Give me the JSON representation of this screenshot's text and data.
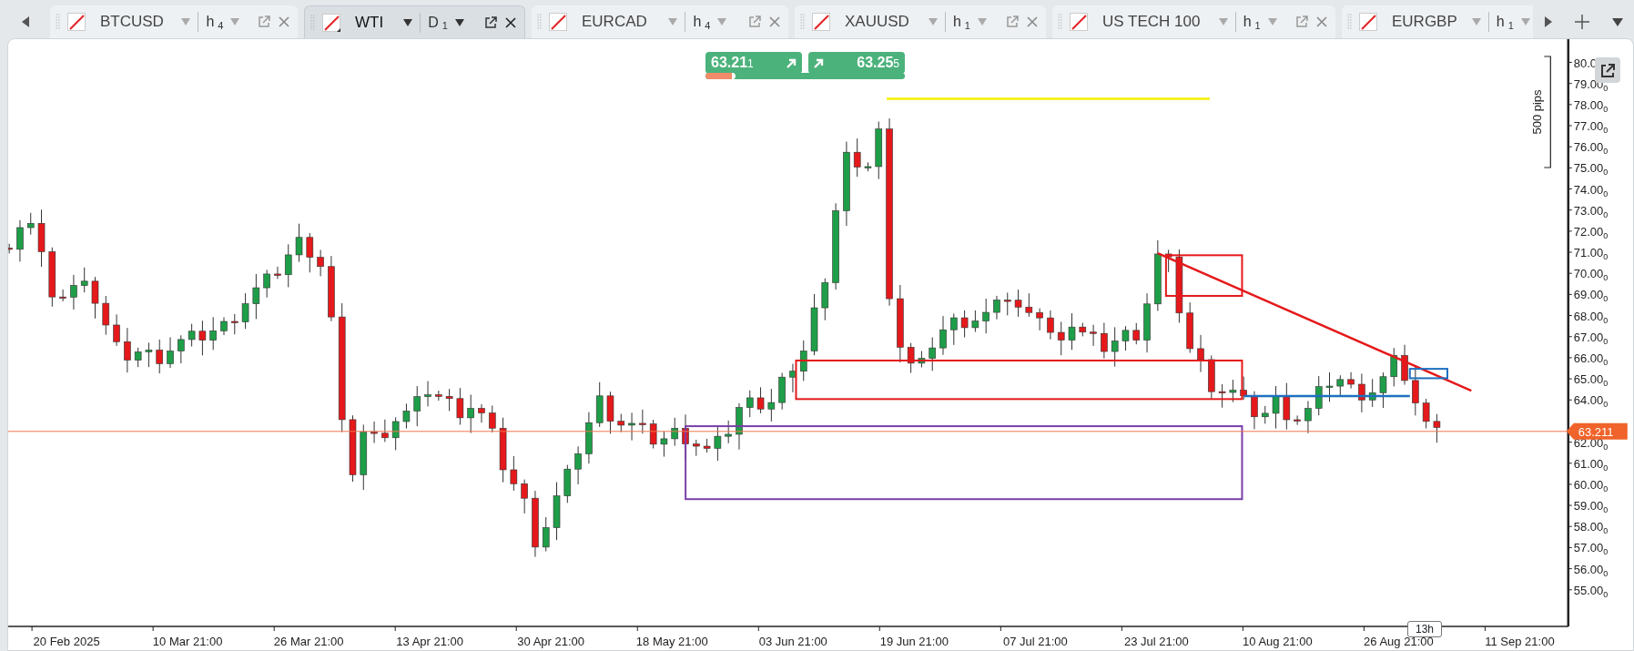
{
  "tabs": [
    {
      "symbol": "BTCUSD",
      "timeframe": "h",
      "timeframe_count": "4",
      "selected": false
    },
    {
      "symbol": "WTI",
      "timeframe": "D",
      "timeframe_count": "1",
      "selected": true
    },
    {
      "symbol": "EURCAD",
      "timeframe": "h",
      "timeframe_count": "4",
      "selected": false
    },
    {
      "symbol": "XAUUSD",
      "timeframe": "h",
      "timeframe_count": "1",
      "selected": false
    },
    {
      "symbol": "US TECH 100",
      "timeframe": "h",
      "timeframe_count": "1",
      "selected": false
    },
    {
      "symbol": "EURGBP",
      "timeframe": "h",
      "timeframe_count": "1",
      "selected": false
    }
  ],
  "quotes": {
    "sell": {
      "price": "63.21",
      "pipette": "1"
    },
    "buy": {
      "price": "63.25",
      "pipette": "5"
    },
    "sentiment": {
      "level": 0.15
    }
  },
  "price_axis": {
    "labels": [
      {
        "price": "80.0"
      },
      {
        "price": "79.00",
        "pipette": "0"
      },
      {
        "price": "78.00",
        "pipette": "0"
      },
      {
        "price": "77.00",
        "pipette": "0"
      },
      {
        "price": "76.00",
        "pipette": "0"
      },
      {
        "price": "75.00",
        "pipette": "0"
      },
      {
        "price": "74.00",
        "pipette": "0"
      },
      {
        "price": "73.00",
        "pipette": "0"
      },
      {
        "price": "72.00",
        "pipette": "0"
      },
      {
        "price": "71.00",
        "pipette": "0"
      },
      {
        "price": "70.00",
        "pipette": "0"
      },
      {
        "price": "69.00",
        "pipette": "0"
      },
      {
        "price": "68.00",
        "pipette": "0"
      },
      {
        "price": "67.00",
        "pipette": "0"
      },
      {
        "price": "66.00",
        "pipette": "0"
      },
      {
        "price": "65.00",
        "pipette": "0"
      },
      {
        "price": "64.00",
        "pipette": "0"
      },
      {
        "price": "62.00",
        "pipette": "0"
      },
      {
        "price": "61.00",
        "pipette": "0"
      },
      {
        "price": "60.00",
        "pipette": "0"
      },
      {
        "price": "59.00",
        "pipette": "0"
      },
      {
        "price": "58.00",
        "pipette": "0"
      },
      {
        "price": "57.00",
        "pipette": "0"
      },
      {
        "price": "56.00",
        "pipette": "0"
      },
      {
        "price": "55.00",
        "pipette": "0"
      }
    ],
    "current_price": "63.211",
    "range_label": "500 pips"
  },
  "time_axis": {
    "labels": [
      "20 Feb 2025",
      "10 Mar 21:00",
      "26 Mar 21:00",
      "13 Apr 21:00",
      "30 Apr 21:00",
      "18 May 21:00",
      "03 Jun 21:00",
      "19 Jun 21:00",
      "07 Jul 21:00",
      "23 Jul 21:00",
      "10 Aug 21:00",
      "26 Aug 21:00",
      "11 Sep 21:00"
    ],
    "countdown": "13h"
  }
}
